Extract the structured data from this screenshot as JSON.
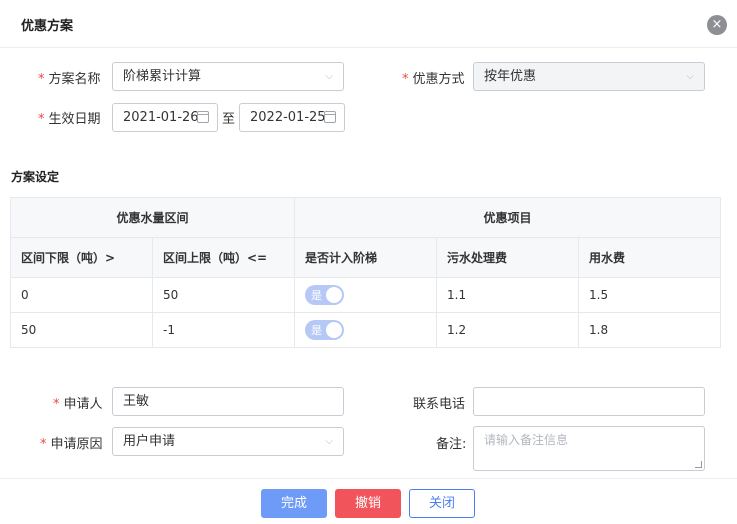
{
  "dialog": {
    "title": "优惠方案",
    "close_icon": "×"
  },
  "form": {
    "scheme_name": {
      "label": "方案名称",
      "value": "阶梯累计计算"
    },
    "discount_method": {
      "label": "优惠方式",
      "value": "按年优惠"
    },
    "effective_date": {
      "label": "生效日期",
      "start": "2021-01-26",
      "separator": "至",
      "end": "2022-01-25"
    }
  },
  "settings": {
    "title": "方案设定",
    "group_headers": [
      "优惠水量区间",
      "优惠项目"
    ],
    "columns": [
      "区间下限（吨）>",
      "区间上限（吨）<=",
      "是否计入阶梯",
      "污水处理费",
      "用水费"
    ],
    "rows": [
      {
        "lower": "0",
        "upper": "50",
        "tier_toggle": "是",
        "sewage_fee": "1.1",
        "water_fee": "1.5"
      },
      {
        "lower": "50",
        "upper": "-1",
        "tier_toggle": "是",
        "sewage_fee": "1.2",
        "water_fee": "1.8"
      }
    ]
  },
  "applicant": {
    "name": {
      "label": "申请人",
      "value": "王敏"
    },
    "phone": {
      "label": "联系电话",
      "value": ""
    },
    "reason": {
      "label": "申请原因",
      "value": "用户申请"
    },
    "remark": {
      "label": "备注:",
      "placeholder": "请输入备注信息"
    }
  },
  "footer": {
    "done": "完成",
    "revoke": "撤销",
    "close": "关闭"
  },
  "colors": {
    "primary": "#6d9bf7",
    "danger": "#f2545b",
    "required": "#f0483e",
    "toggle_on": "#b6c8f5"
  }
}
